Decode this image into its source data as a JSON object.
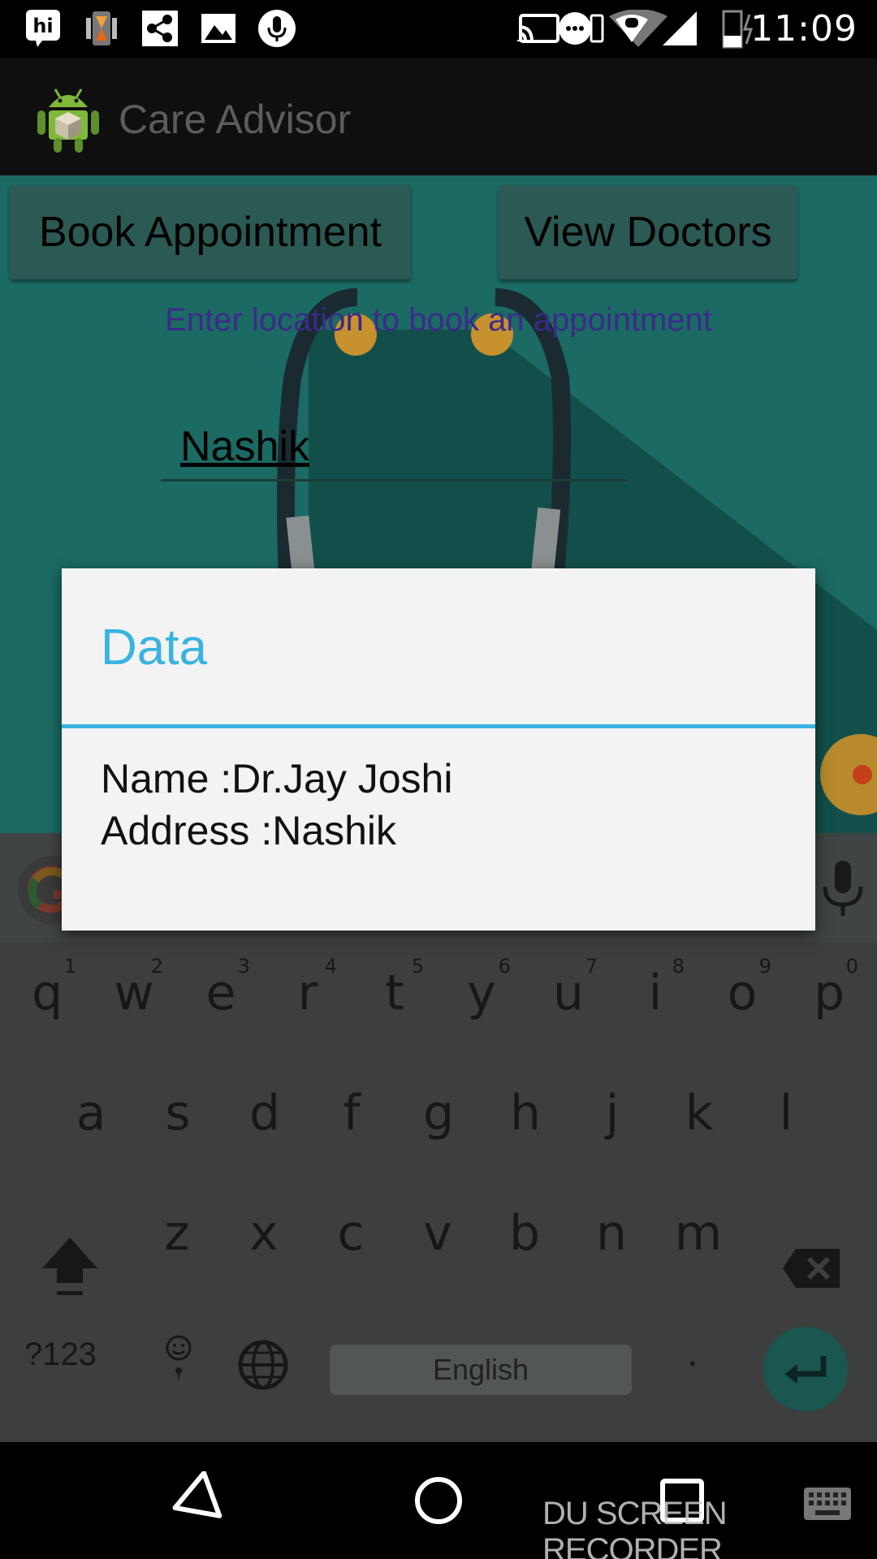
{
  "status_bar": {
    "time": "11:09",
    "left_icons": [
      "hi-app-icon",
      "hourglass-icon",
      "share-icon",
      "image-icon",
      "mic-icon"
    ],
    "right_icons": [
      "cast-icon",
      "more-icon",
      "wifi-icon",
      "signal-icon",
      "battery-icon"
    ]
  },
  "action_bar": {
    "title": "Care Advisor",
    "logo": "android-logo"
  },
  "content": {
    "book_button": "Book Appointment",
    "view_button": "View Doctors",
    "hint": "Enter location to book an appointment",
    "location_value": "Nashik"
  },
  "dialog": {
    "title": "Data",
    "name_line": "Name :Dr.Jay Joshi",
    "address_line": "Address :Nashik"
  },
  "keyboard": {
    "row1": [
      {
        "k": "q",
        "h": "1"
      },
      {
        "k": "w",
        "h": "2"
      },
      {
        "k": "e",
        "h": "3"
      },
      {
        "k": "r",
        "h": "4"
      },
      {
        "k": "t",
        "h": "5"
      },
      {
        "k": "y",
        "h": "6"
      },
      {
        "k": "u",
        "h": "7"
      },
      {
        "k": "i",
        "h": "8"
      },
      {
        "k": "o",
        "h": "9"
      },
      {
        "k": "p",
        "h": "0"
      }
    ],
    "row2": [
      "a",
      "s",
      "d",
      "f",
      "g",
      "h",
      "j",
      "k",
      "l"
    ],
    "row3": [
      "z",
      "x",
      "c",
      "v",
      "b",
      "n",
      "m"
    ],
    "symbols": "?123",
    "space": "English",
    "period": ".",
    "colors": {
      "background": "#3d3f3f",
      "enter": "#19574f"
    }
  },
  "nav_bar": {
    "watermark": "DU SCREEN RECORDER"
  },
  "colors": {
    "accent": "#39b3e0",
    "app_bg": "#1b6a63",
    "hint": "#3b2a8a"
  }
}
